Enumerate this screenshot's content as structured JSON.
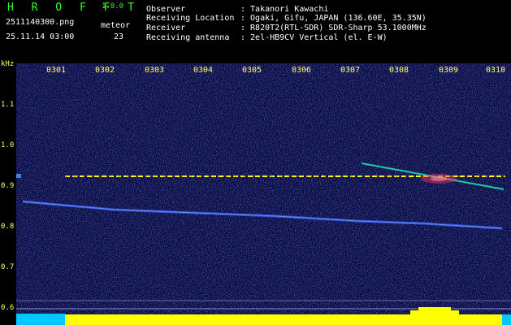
{
  "app": {
    "name": "H R O F F T",
    "version": "1.0.0"
  },
  "file": {
    "name": "2511140300.png",
    "datetime": "25.11.14 03:00"
  },
  "meteor": {
    "label": "meteor",
    "count": "23"
  },
  "info": [
    {
      "label": "Observer",
      "value": ": Takanori Kawachi"
    },
    {
      "label": "Receiving Location",
      "value": ": Ogaki, Gifu, JAPAN (136.60E, 35.35N)"
    },
    {
      "label": "Receiver",
      "value": ": R820T2(RTL-SDR) SDR-Sharp 53.1000MHz"
    },
    {
      "label": "Receiving antenna",
      "value": ": 2el-HB9CV Vertical (el. E-W)"
    }
  ],
  "axis": {
    "unit": "kHz",
    "y_ticks": [
      "1.1",
      "1.0",
      "0.9",
      "0.8",
      "0.7",
      "0.6"
    ],
    "x_ticks": [
      "0301",
      "0302",
      "0303",
      "0304",
      "0305",
      "0306",
      "0307",
      "0308",
      "0309",
      "0310"
    ]
  },
  "colors": {
    "background": "#000000",
    "spectrogram_bg": "#0a0a3c",
    "axis_text": "#ffff66",
    "title_text": "#33ff33",
    "trace": "#4a78ff",
    "carrier": "#ffff00",
    "signal_bar": "#ffff00",
    "signal_bar_start": "#00c8ff"
  }
}
